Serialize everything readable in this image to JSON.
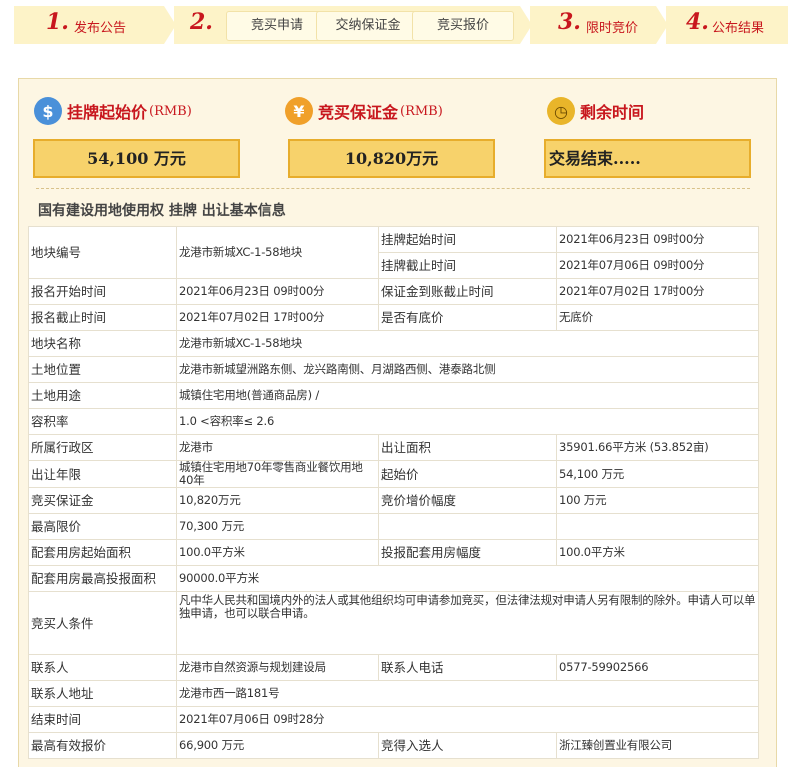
{
  "steps": [
    {
      "num": "1.",
      "label": "发布公告"
    },
    {
      "num": "2.",
      "subs": [
        "竞买申请",
        "交纳保证金",
        "竞买报价"
      ]
    },
    {
      "num": "3.",
      "label": "限时竞价"
    },
    {
      "num": "4.",
      "label": "公布结果"
    }
  ],
  "summary": {
    "start_price": {
      "title": "挂牌起始价",
      "unit": "(RMB)",
      "value": "54,100 万元"
    },
    "deposit": {
      "title": "竞买保证金",
      "unit": "(RMB)",
      "value": "10,820万元"
    },
    "remaining": {
      "title": "剩余时间",
      "value": "交易结束....."
    }
  },
  "section_title": "国有建设用地使用权 挂牌 出让基本信息",
  "table": {
    "rows": [
      {
        "k1": "地块编号",
        "v1": "龙港市新城XC-1-58地块",
        "k2a": "挂牌起始时间",
        "v2a": "2021年06月23日 09时00分",
        "k2b": "挂牌截止时间",
        "v2b": "2021年07月06日 09时00分"
      },
      {
        "k1": "报名开始时间",
        "v1": "2021年06月23日 09时00分",
        "k2": "保证金到账截止时间",
        "v2": "2021年07月02日 17时00分"
      },
      {
        "k1": "报名截止时间",
        "v1": "2021年07月02日 17时00分",
        "k2": "是否有底价",
        "v2": "无底价"
      },
      {
        "k1": "地块名称",
        "v1": "龙港市新城XC-1-58地块"
      },
      {
        "k1": "土地位置",
        "v1": "龙港市新城望洲路东侧、龙兴路南侧、月湖路西侧、港泰路北侧"
      },
      {
        "k1": "土地用途",
        "v1": "城镇住宅用地(普通商品房) /"
      },
      {
        "k1": "容积率",
        "v1": "1.0 <容积率≤ 2.6"
      },
      {
        "k1": "所属行政区",
        "v1": "龙港市",
        "k2": "出让面积",
        "v2": "35901.66平方米 (53.852亩)"
      },
      {
        "k1": "出让年限",
        "v1": "城镇住宅用地70年零售商业餐饮用地40年",
        "k2": "起始价",
        "v2": "54,100 万元"
      },
      {
        "k1": "竞买保证金",
        "v1": "10,820万元",
        "k2": "竞价增价幅度",
        "v2": "100 万元"
      },
      {
        "k1": "最高限价",
        "v1": "70,300 万元",
        "k2": "",
        "v2": ""
      },
      {
        "k1": "配套用房起始面积",
        "v1": "100.0平方米",
        "k2": "投报配套用房幅度",
        "v2": "100.0平方米"
      },
      {
        "k1": "配套用房最高投报面积",
        "v1": "90000.0平方米"
      },
      {
        "k1": "竞买人条件",
        "v1": "凡中华人民共和国境内外的法人或其他组织均可申请参加竞买，但法律法规对申请人另有限制的除外。申请人可以单独申请，也可以联合申请。"
      },
      {
        "k1": "联系人",
        "v1": "龙港市自然资源与规划建设局",
        "k2": "联系人电话",
        "v2": "0577-59902566"
      },
      {
        "k1": "联系人地址",
        "v1": "龙港市西一路181号"
      },
      {
        "k1": "结束时间",
        "v1": "2021年07月06日 09时28分"
      },
      {
        "k1": "最高有效报价",
        "v1": "66,900 万元",
        "k2": "竞得入选人",
        "v2": "浙江臻创置业有限公司"
      }
    ]
  },
  "colors": {
    "accent_red": "#c8171e",
    "step_bg": "#fdf3c8",
    "box_fill": "#f7d26b",
    "box_border": "#e7ad2c",
    "panel_bg": "#fdf6e3"
  },
  "icons": {
    "start_price": "coin-clock-icon",
    "deposit": "coins-bag-icon",
    "remaining": "alarm-clock-icon"
  }
}
